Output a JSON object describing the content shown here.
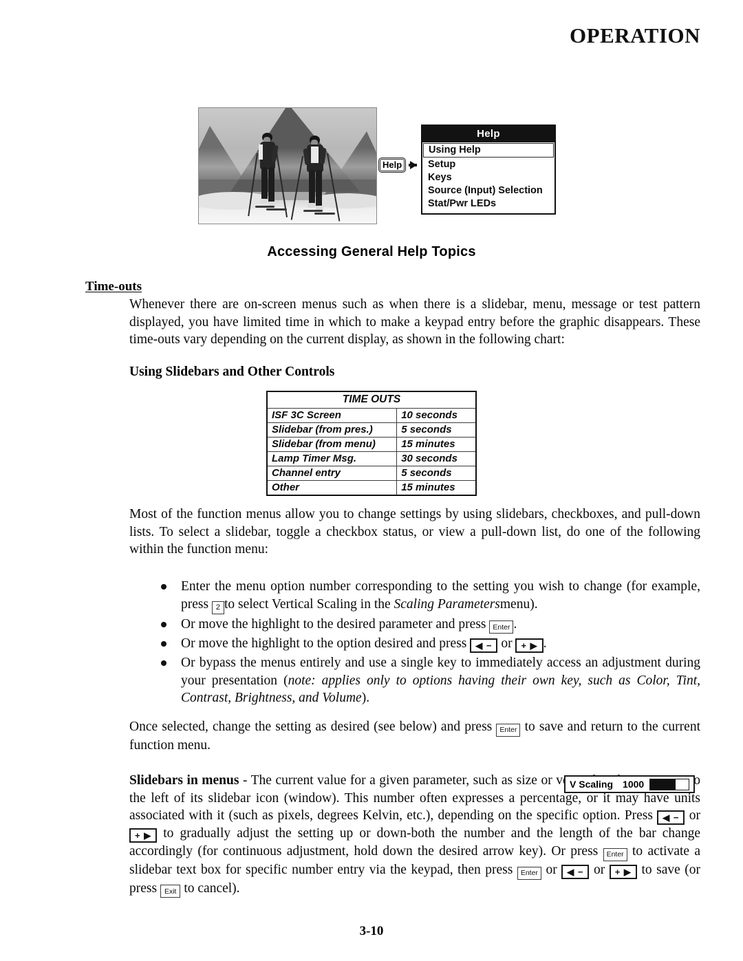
{
  "header": {
    "running_title": "OPERATION"
  },
  "figure": {
    "photo_alt": "two cross-country skiers on snow with mountains behind",
    "help_key_label": "Help",
    "menu": {
      "title": "Help",
      "items": [
        {
          "label": "Using Help",
          "selected": true
        },
        {
          "label": "Setup",
          "selected": false
        },
        {
          "label": "Keys",
          "selected": false
        },
        {
          "label": "Source (Input) Selection",
          "selected": false
        },
        {
          "label": "Stat/Pwr LEDs",
          "selected": false
        }
      ]
    },
    "caption": "Accessing General Help Topics"
  },
  "sections": {
    "timeouts_heading": "Time-outs",
    "timeouts_paragraph": "Whenever there are on-screen menus such as when there is a slidebar, menu, message or test pattern displayed, you have limited time in which to make a keypad entry before the graphic disappears. These time-outs vary depending on the current display, as shown in the following chart:",
    "slidebars_heading": "Using Slidebars and Other Controls",
    "intro_paragraph": "Most of the function menus allow you to change settings by using slidebars, checkboxes, and pull-down lists. To select a slidebar, toggle a checkbox status, or view a pull-down list, do one of the following within the function menu:",
    "once_selected_part1": "Once selected, change the setting as desired (see below) and press",
    "once_selected_part2": "to save and return to the current function menu."
  },
  "timeouts_table": {
    "title": "TIME OUTS",
    "rows": [
      {
        "name": "ISF 3C Screen",
        "value": "10 seconds"
      },
      {
        "name": "Slidebar (from pres.)",
        "value": "5 seconds"
      },
      {
        "name": "Slidebar (from menu)",
        "value": "15 minutes"
      },
      {
        "name": "Lamp Timer Msg.",
        "value": "30 seconds"
      },
      {
        "name": "Channel entry",
        "value": "5 seconds"
      },
      {
        "name": "Other",
        "value": "15 minutes"
      }
    ]
  },
  "bullets": [
    {
      "id": "enter-menu-option-number",
      "part1": "Enter the menu option number corresponding to the setting you wish to change (for example, press",
      "key1": "2",
      "part2": "to select Vertical Scaling in the",
      "italic1": "Scaling Parameters",
      "part3": "menu)."
    },
    {
      "id": "move-highlight-enter",
      "part1": "Or move the highlight to the desired parameter and press",
      "key1": "Enter",
      "part2": "."
    },
    {
      "id": "move-highlight-arrows",
      "part1": "Or move the highlight to the option desired and press",
      "key1": "◀ −",
      "part2": "or",
      "key2": "+ ▶",
      "part3": "."
    },
    {
      "id": "bypass-menus-single-key",
      "part1": "Or bypass the menus entirely and use a single key to immediately access an adjustment during your presentation (",
      "italic1": "note: applies only to options having their own key, such as Color, Tint, Contrast, Brightness, and Volume",
      "part2": ")."
    }
  ],
  "slidebars_paragraph": {
    "lead_bold": "Slidebars in menus",
    "p1": "- The current value for a given parameter, such as size or vertical scaling, appears to the left of its slidebar icon (window). This number often expresses a percentage, or it may have units associated with it (such as pixels, degrees Kelvin, etc.), depending on the specific option. Press",
    "k1": "◀ −",
    "p2": "or",
    "k2": "+ ▶",
    "p3": "to gradually adjust the setting up or down-both the number and the length of the bar change accordingly (for continuous adjustment, hold down the desired arrow key). Or press",
    "k3": "Enter",
    "p4": "to activate a slidebar text box for specific number entry via the keypad, then press",
    "k4": "Enter",
    "p5": "or",
    "k5": "◀ −",
    "p6": "or",
    "k6": "+ ▶",
    "p7": "to save (or press",
    "k7": "Exit",
    "p8": "to cancel)."
  },
  "slidebar_widget": {
    "label": "V Scaling",
    "value": "1000",
    "fill_percent": 66
  },
  "footer": {
    "page_number": "3-10"
  },
  "colors": {
    "ink": "#000000",
    "paper": "#ffffff",
    "osd_titlebar": "#121212"
  }
}
